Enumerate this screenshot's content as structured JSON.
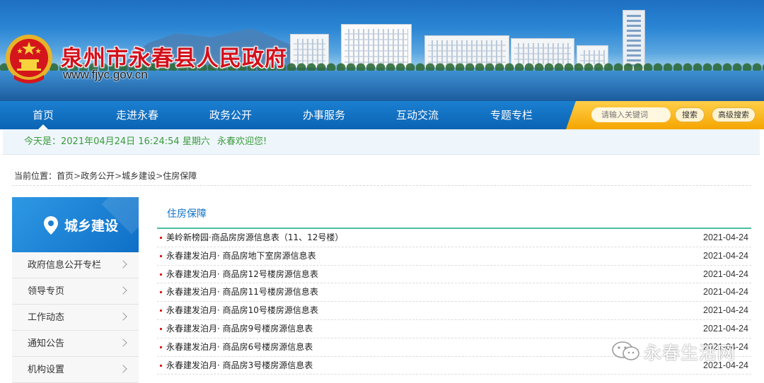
{
  "header": {
    "site_title": "泉州市永春县人民政府",
    "site_url": "www.fjyc.gov.cn"
  },
  "nav": {
    "items": [
      {
        "label": "首页",
        "active": true
      },
      {
        "label": "走进永春"
      },
      {
        "label": "政务公开"
      },
      {
        "label": "办事服务"
      },
      {
        "label": "互动交流"
      },
      {
        "label": "专题专栏"
      }
    ],
    "search_placeholder": "请输入关键词",
    "search_button": "搜索",
    "advanced_search_button": "高级搜索"
  },
  "infobar": {
    "date_text": "今天是：2021年04月24日 16:24:54 星期六",
    "welcome": "永春欢迎您!"
  },
  "breadcrumb": {
    "prefix": "当前位置：",
    "items": [
      "首页",
      "政务公开",
      "城乡建设",
      "住房保障"
    ],
    "separator": ">"
  },
  "sidebar": {
    "title": "城乡建设",
    "items": [
      {
        "label": "政府信息公开专栏"
      },
      {
        "label": "领导专页"
      },
      {
        "label": "工作动态"
      },
      {
        "label": "通知公告"
      },
      {
        "label": "机构设置"
      }
    ]
  },
  "main": {
    "section_title": "住房保障",
    "articles": [
      {
        "title": "美岭新榜园·商品房房源信息表（11、12号楼）",
        "date": "2021-04-24"
      },
      {
        "title": "永春建发泊月· 商品房地下室房源信息表",
        "date": "2021-04-24"
      },
      {
        "title": "永春建发泊月· 商品房12号楼房源信息表",
        "date": "2021-04-24"
      },
      {
        "title": "永春建发泊月· 商品房11号楼房源信息表",
        "date": "2021-04-24"
      },
      {
        "title": "永春建发泊月· 商品房10号楼房源信息表",
        "date": "2021-04-24"
      },
      {
        "title": "永春建发泊月· 商品房9号楼房源信息表",
        "date": "2021-04-24"
      },
      {
        "title": "永春建发泊月· 商品房6号楼房源信息表",
        "date": "2021-04-24"
      },
      {
        "title": "永春建发泊月· 商品房3号楼房源信息表",
        "date": "2021-04-24"
      }
    ]
  },
  "watermark": {
    "text": "永春生活网"
  },
  "colors": {
    "nav_blue": "#0b63b4",
    "title_red": "#d3101b",
    "accent_green": "#4bbf9f",
    "search_orange": "#f5a500"
  },
  "icons": [
    "national-emblem-icon",
    "location-pin-icon",
    "chevron-right-icon",
    "wechat-icon"
  ]
}
